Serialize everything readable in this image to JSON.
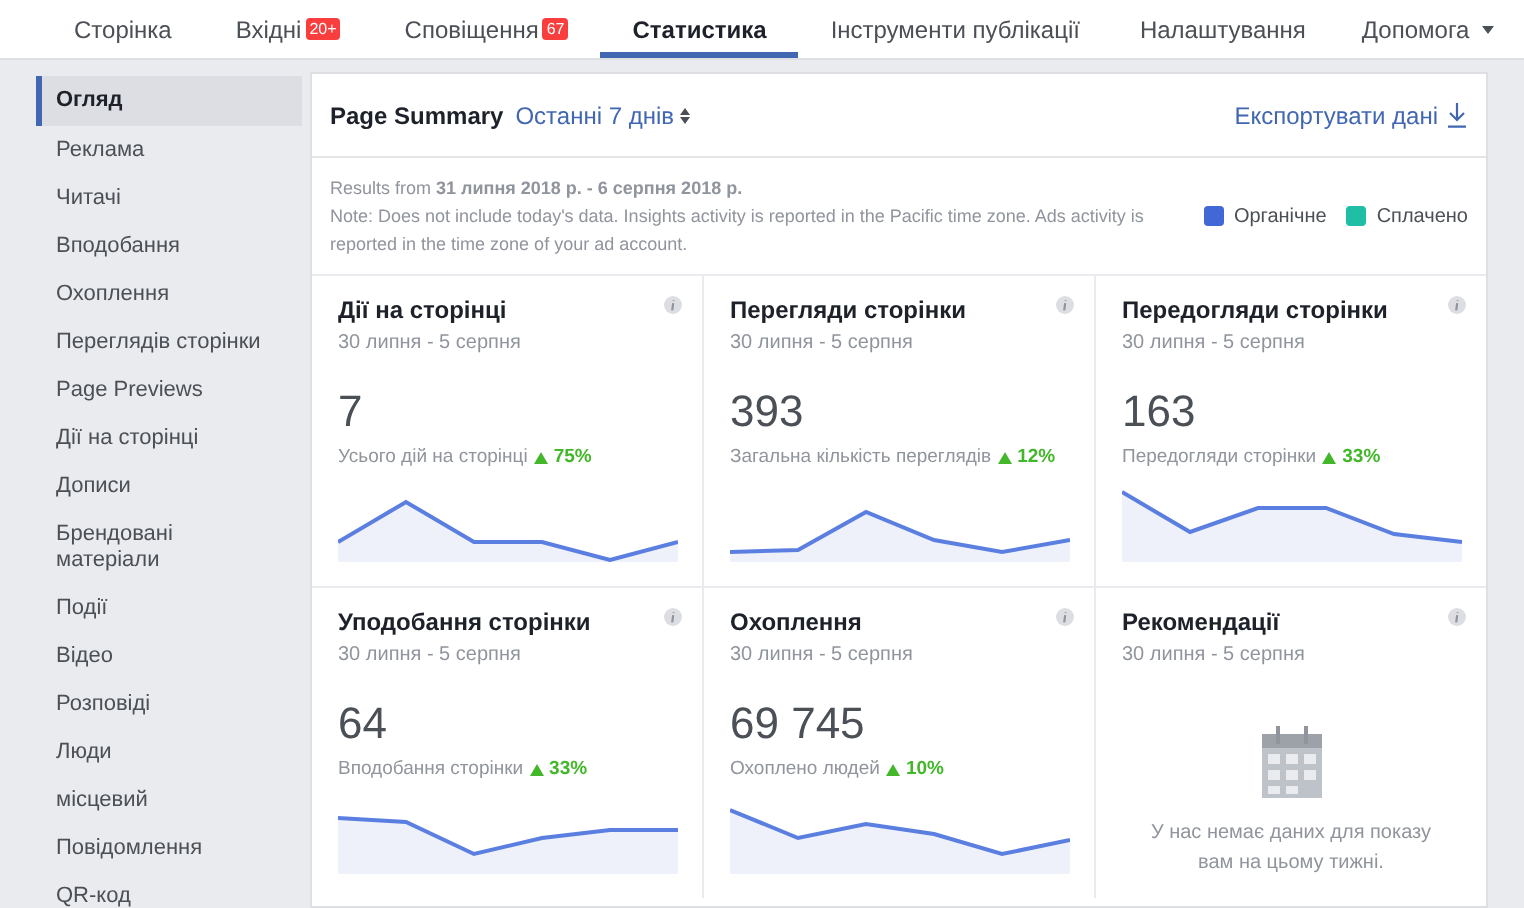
{
  "top_nav": {
    "tabs": [
      {
        "label": "Сторінка",
        "selected": false
      },
      {
        "label": "Вхідні",
        "badge": "20+",
        "selected": false
      },
      {
        "label": "Сповіщення",
        "badge": "67",
        "selected": false
      },
      {
        "label": "Статистика",
        "selected": true
      },
      {
        "label": "Інструменти публікації",
        "selected": false
      }
    ],
    "right": [
      {
        "label": "Налаштування"
      },
      {
        "label": "Допомога",
        "dropdown": true
      }
    ]
  },
  "sidebar": {
    "items": [
      {
        "label": "Огляд",
        "selected": true
      },
      {
        "label": "Реклама",
        "selected": false
      },
      {
        "label": "Читачі",
        "selected": false
      },
      {
        "label": "Вподобання",
        "selected": false
      },
      {
        "label": "Охоплення",
        "selected": false
      },
      {
        "label": "Переглядів сторінки",
        "selected": false
      },
      {
        "label": "Page Previews",
        "selected": false
      },
      {
        "label": "Дії на сторінці",
        "selected": false
      },
      {
        "label": "Дописи",
        "selected": false
      },
      {
        "label": "Брендовані матеріали",
        "selected": false
      },
      {
        "label": "Події",
        "selected": false
      },
      {
        "label": "Відео",
        "selected": false
      },
      {
        "label": "Розповіді",
        "selected": false
      },
      {
        "label": "Люди",
        "selected": false
      },
      {
        "label": "місцевий",
        "selected": false
      },
      {
        "label": "Повідомлення",
        "selected": false
      },
      {
        "label": "QR-код",
        "selected": false
      }
    ]
  },
  "summary": {
    "title": "Page Summary",
    "period": "Останні 7 днів",
    "export": "Експортувати дані",
    "results": "Results from **31 липня 2018 р. - 6 серпня 2018 р.**",
    "note": "Note: Does not include today's data. Insights activity is reported in the Pacific time zone. Ads activity is reported in the time zone of your ad account.",
    "legend": [
      {
        "label": "Органічне",
        "color": "#4267d6"
      },
      {
        "label": "Сплачено",
        "color": "#1fbfa6"
      }
    ]
  },
  "cards": [
    {
      "kind": "metric",
      "title": "Дії на сторінці",
      "dates": "30 липня - 5 серпня",
      "value": "7",
      "caption": "Усього дій на сторінці",
      "change": "75%"
    },
    {
      "kind": "metric",
      "title": "Перегляди сторінки",
      "dates": "30 липня - 5 серпня",
      "value": "393",
      "caption": "Загальна кількість переглядів",
      "change": "12%"
    },
    {
      "kind": "metric",
      "title": "Передогляди сторінки",
      "dates": "30 липня - 5 серпня",
      "value": "163",
      "caption": "Передогляди сторінки",
      "change": "33%"
    },
    {
      "kind": "metric",
      "title": "Уподобання сторінки",
      "dates": "30 липня - 5 серпня",
      "value": "64",
      "caption": "Вподобання сторінки",
      "change": "33%"
    },
    {
      "kind": "metric",
      "title": "Охоплення",
      "dates": "30 липня - 5 серпня",
      "value": "69 745",
      "caption": "Охоплено людей",
      "change": "10%"
    },
    {
      "kind": "empty",
      "title": "Рекомендації",
      "dates": "30 липня - 5 серпня",
      "message": "У нас немає даних для показу вам на цьому тижні."
    }
  ]
}
